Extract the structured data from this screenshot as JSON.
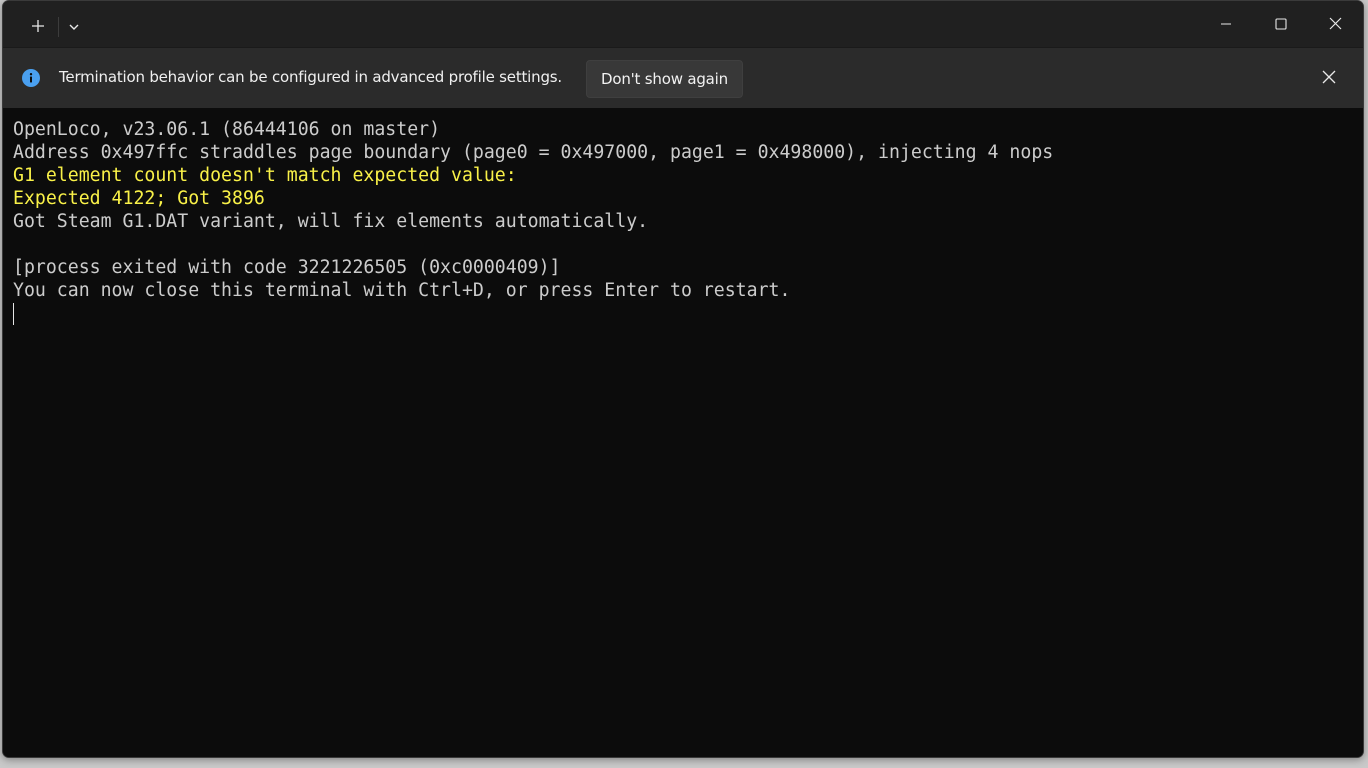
{
  "titlebar": {
    "new_tab_icon": "plus-icon",
    "dropdown_icon": "chevron-down-icon",
    "window_controls": [
      "minimize-icon",
      "maximize-icon",
      "close-icon"
    ]
  },
  "infobar": {
    "icon": "info-icon",
    "message": "Termination behavior can be configured in advanced profile settings.",
    "button_label": "Don't show again",
    "close_icon": "close-icon"
  },
  "terminal": {
    "lines": [
      "OpenLoco, v23.06.1 (86444106 on master)",
      "Address 0x497ffc straddles page boundary (page0 = 0x497000, page1 = 0x498000), injecting 4 nops",
      "G1 element count doesn't match expected value:",
      "Expected 4122; Got 3896",
      "Got Steam G1.DAT variant, will fix elements automatically.",
      "",
      "[process exited with code 3221226505 (0xc0000409)]",
      "You can now close this terminal with Ctrl+D, or press Enter to restart."
    ],
    "colors": {
      "default": "#cccccc",
      "warning": "#f9f148",
      "background": "#0c0c0c"
    }
  }
}
